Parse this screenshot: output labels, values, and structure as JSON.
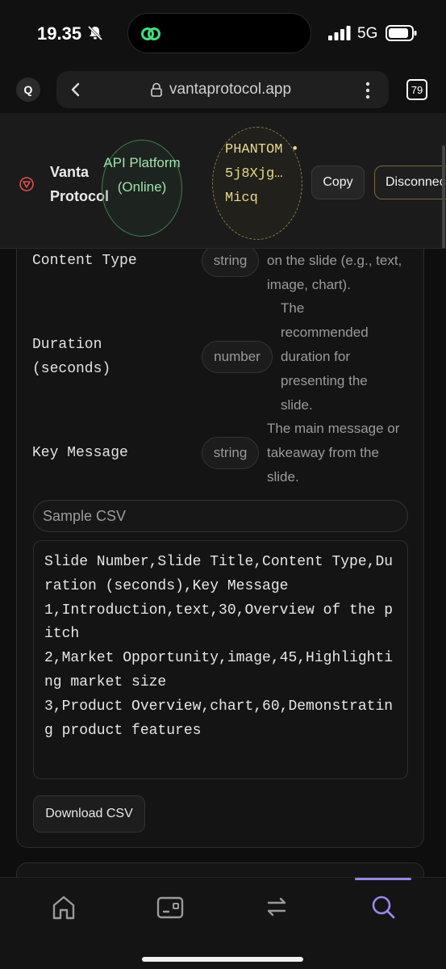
{
  "status_bar": {
    "time": "19.35",
    "network": "5G"
  },
  "browser": {
    "url": "vantaprotocol.app",
    "tab_count": "79",
    "search_btn": "Q"
  },
  "header": {
    "brand_name": "Vanta Protocol",
    "api_status": "API Platform (Online)",
    "wallet_label": "PHANTOM •",
    "wallet_address": "5j8Xjg… Micq",
    "copy_label": "Copy",
    "disconnect_label": "Disconnect"
  },
  "fields": [
    {
      "name": "Content Type",
      "type": "string",
      "description": "on the slide (e.g., text, image, chart)."
    },
    {
      "name": "Duration (seconds)",
      "type": "number",
      "description": "The recommended duration for presenting the slide."
    },
    {
      "name": "Key Message",
      "type": "string",
      "description": "The main message or takeaway from the slide."
    }
  ],
  "sample": {
    "label": "Sample CSV",
    "csv": "Slide Number,Slide Title,Content Type,Duration (seconds),Key Message\n1,Introduction,text,30,Overview of the pitch\n2,Market Opportunity,image,45,Highlighting market size\n3,Product Overview,chart,60,Demonstrating product features",
    "download_label": "Download CSV"
  },
  "nav": {
    "items": [
      "home-icon",
      "wallet-icon",
      "swap-icon",
      "search-icon"
    ],
    "active": "search-icon"
  },
  "colors": {
    "accent": "#9b87e8",
    "online": "#9fe3ae",
    "wallet": "#e9d98a"
  }
}
